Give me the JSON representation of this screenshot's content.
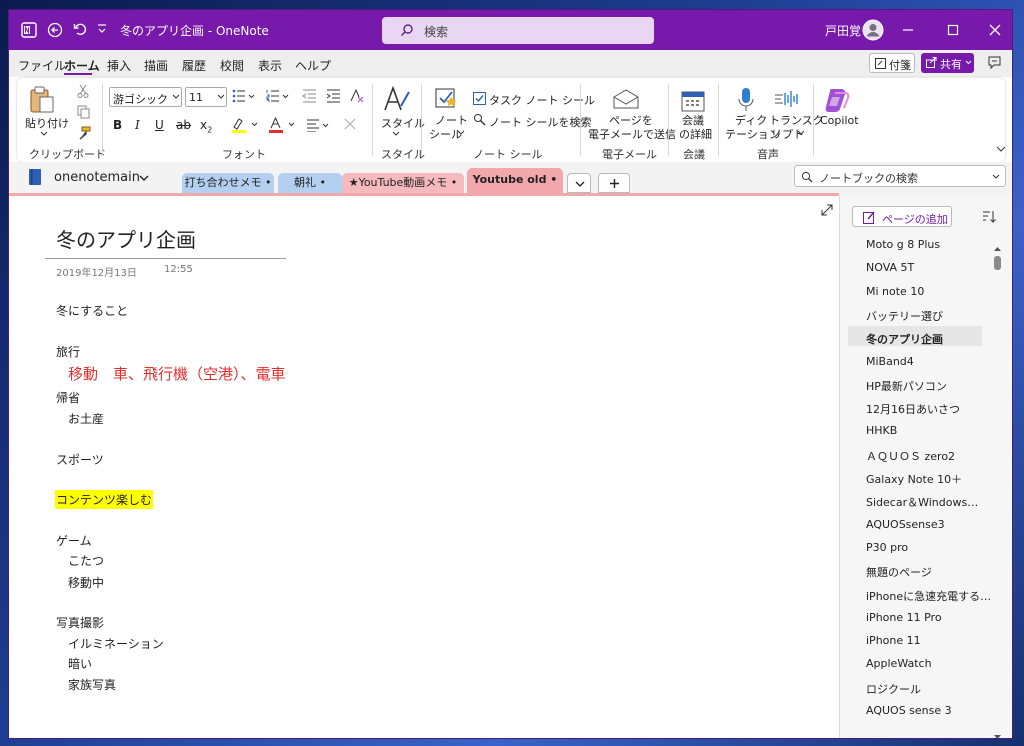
{
  "window": {
    "title": "冬のアプリ企画  -  OneNote",
    "search_placeholder": "検索",
    "user_name": "戸田覚"
  },
  "menu": {
    "items": [
      "ファイル",
      "ホーム",
      "挿入",
      "描画",
      "履歴",
      "校閲",
      "表示",
      "ヘルプ"
    ],
    "active_index": 1,
    "tag_label": "付箋",
    "share_label": "共有"
  },
  "ribbon": {
    "paste_label": "貼り付け",
    "font_name": "游ゴシック",
    "font_size": "11",
    "style_label": "スタイル",
    "note_tag_line1": "ノート",
    "note_tag_line2": "シール",
    "task_tag_label": "タスク ノート シール",
    "find_tags_label": "ノート シールを検索",
    "email_line1": "ページを",
    "email_line2": "電子メールで送信",
    "meeting_line1": "会議",
    "meeting_line2": "の詳細",
    "dictate_line1": "ディク",
    "dictate_line2": "テーション",
    "transcribe_line1": "トランスク",
    "transcribe_line2": "リプト",
    "copilot_label": "Copilot",
    "group_clipboard": "クリップボード",
    "group_font": "フォント",
    "group_style": "スタイル",
    "group_tags": "ノート シール",
    "group_email": "電子メール",
    "group_meeting": "会議",
    "group_voice": "音声"
  },
  "notebook": {
    "name": "onenotemain",
    "search_placeholder": "ノートブックの検索",
    "sections": [
      {
        "label": "打ち合わせメモ",
        "color": "#b3d0f0"
      },
      {
        "label": "朝礼",
        "color": "#b3d0f0"
      },
      {
        "label": "★YouTube動画メモ",
        "color": "#f6b9bd"
      },
      {
        "label": "Youtube old",
        "color": "#f2a7ac"
      }
    ]
  },
  "page": {
    "title": "冬のアプリ企画",
    "date": "2019年12月13日",
    "time": "12:55",
    "lines": {
      "l1": "冬にすること",
      "l2": "旅行",
      "l3": "移動　車、飛行機（空港）、電車",
      "l4": "帰省",
      "l5": "お土産",
      "l6": "スポーツ",
      "l7": "コンテンツ楽しむ",
      "l8": "ゲーム",
      "l9": "こたつ",
      "l10": "移動中",
      "l11": "写真撮影",
      "l12": "イルミネーション",
      "l13": "暗い",
      "l14": "家族写真"
    },
    "red_color": "#e0302e",
    "highlight_color": "#ffff00"
  },
  "pages_panel": {
    "add_label": "ページの追加",
    "items": [
      "Moto g 8 Plus",
      "NOVA 5T",
      "Mi note 10",
      "バッテリー選び",
      "冬のアプリ企画",
      "MiBand4",
      "HP最新パソコン",
      "12月16日あいさつ",
      "HHKB",
      "ＡＱＵＯＳ zero2",
      "Galaxy Note 10＋",
      "Sidecar＆Windows…",
      "AQUOSsense3",
      "P30 pro",
      "無題のページ",
      "iPhoneに急速充電する…",
      "iPhone 11 Pro",
      "iPhone 11",
      "AppleWatch",
      "ロジクール",
      "AQUOS sense 3"
    ],
    "selected_index": 4
  },
  "colors": {
    "accent": "#7719aa"
  }
}
